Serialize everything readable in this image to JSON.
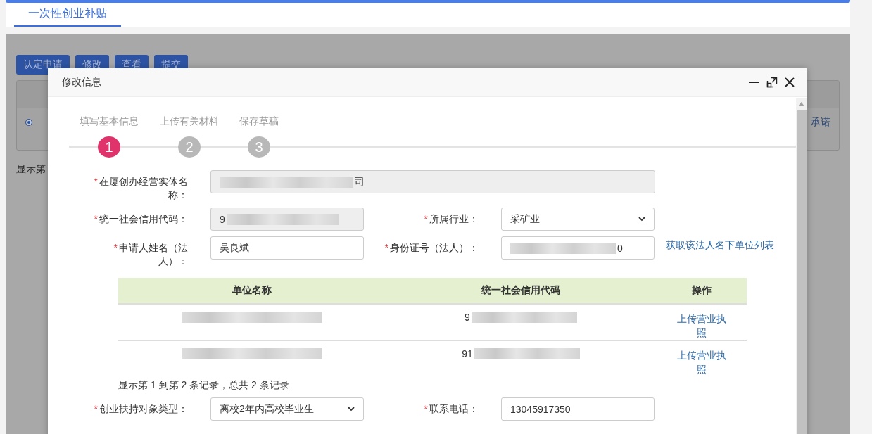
{
  "top_tab": {
    "label": "一次性创业补贴",
    "selected": true
  },
  "background": {
    "buttons": [
      "认定申请",
      "修改",
      "查看",
      "提交"
    ],
    "radio_checked": true,
    "link": "承诺",
    "record_text": "显示第"
  },
  "dialog": {
    "title": "修改信息",
    "required_mark": "*",
    "steps": [
      {
        "label": "填写基本信息",
        "number": "1",
        "selected": true
      },
      {
        "label": "上传有关材料",
        "number": "2",
        "selected": false
      },
      {
        "label": "保存草稿",
        "number": "3",
        "selected": false
      }
    ],
    "entity_name": {
      "label": "在厦创办经营实体名称：",
      "required": true,
      "value_end": "司",
      "redacted": true,
      "disabled": true
    },
    "credit_code": {
      "label": "统一社会信用代码：",
      "required": true,
      "value_start": "9",
      "redacted": true,
      "disabled": true
    },
    "industry": {
      "label": "所属行业：",
      "required": true,
      "value": "采矿业"
    },
    "applicant": {
      "label": "申请人姓名（法人）：",
      "required": true,
      "value": "吴良斌"
    },
    "id_number": {
      "label": "身份证号（法人）：",
      "required": true,
      "value_end": "0",
      "redacted": true
    },
    "fetch_link": "获取该法人名下单位列表",
    "unit_table": {
      "columns": [
        "单位名称",
        "统一社会信用代码",
        "操作"
      ],
      "rows": [
        {
          "name_redacted": true,
          "code_start": "9",
          "action": "上传营业执照"
        },
        {
          "name_redacted": true,
          "code_start": "91",
          "action": "上传营业执照"
        }
      ],
      "footer": "显示第 1 到第 2 条记录，总共 2 条记录"
    },
    "support_type": {
      "label": "创业扶持对象类型：",
      "required": true,
      "value": "离校2年内高校毕业生"
    },
    "phone": {
      "label": "联系电话：",
      "required": true,
      "value": "13045917350"
    }
  }
}
